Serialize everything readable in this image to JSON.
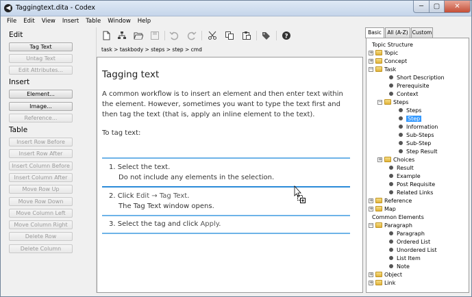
{
  "window": {
    "title": "Taggingtext.dita - Codex",
    "min": "─",
    "max": "▢",
    "close": "✕",
    "app_icon": "◀"
  },
  "menu": [
    "File",
    "Edit",
    "View",
    "Insert",
    "Table",
    "Window",
    "Help"
  ],
  "left": {
    "edit_heading": "Edit",
    "edit_buttons": [
      {
        "label": "Tag Text",
        "enabled": true
      },
      {
        "label": "Untag Text",
        "enabled": false
      },
      {
        "label": "Edit Attributes...",
        "enabled": false
      }
    ],
    "insert_heading": "Insert",
    "insert_buttons": [
      {
        "label": "Element...",
        "enabled": true
      },
      {
        "label": "Image...",
        "enabled": true
      },
      {
        "label": "Reference...",
        "enabled": false
      }
    ],
    "table_heading": "Table",
    "table_buttons": [
      {
        "label": "Insert Row Before",
        "enabled": false
      },
      {
        "label": "Insert Row After",
        "enabled": false
      },
      {
        "label": "Insert Column Before",
        "enabled": false
      },
      {
        "label": "Insert Column After",
        "enabled": false
      },
      {
        "label": "Move Row Up",
        "enabled": false
      },
      {
        "label": "Move Row Down",
        "enabled": false
      },
      {
        "label": "Move Column Left",
        "enabled": false
      },
      {
        "label": "Move Column Right",
        "enabled": false
      },
      {
        "label": "Delete Row",
        "enabled": false
      },
      {
        "label": "Delete Column",
        "enabled": false
      }
    ]
  },
  "toolbar": [
    "new-file-icon",
    "structure-icon",
    "open-folder-icon",
    "save-icon",
    "undo-icon",
    "redo-icon",
    "cut-icon",
    "copy-icon",
    "paste-icon",
    "tags-icon",
    "help-icon"
  ],
  "breadcrumb": "task > taskbody > steps > step > cmd",
  "editor": {
    "title": "Tagging text",
    "para": "A common workflow is to insert an element and then enter text within the element. However, sometimes you want to type the text first and then tag the text (that is, apply an inline element to the text).",
    "intro": "To tag text:",
    "steps": [
      {
        "num": "1.",
        "pre": "Select the text.",
        "sub": "Do not include any elements in the selection."
      },
      {
        "num": "2.",
        "pre": "Click ",
        "ui": "Edit → Tag Text",
        "post": ".",
        "sub": "The Tag Text window opens."
      },
      {
        "num": "3.",
        "pre": "Select the tag and click ",
        "ui": "Apply",
        "post": "."
      }
    ]
  },
  "tabs": [
    "Basic",
    "All (A-Z)",
    "Custom"
  ],
  "tree": [
    {
      "label": "Topic Structure",
      "depth": 0,
      "kind": "root"
    },
    {
      "label": "Topic",
      "depth": 1,
      "kind": "folder",
      "exp": "+"
    },
    {
      "label": "Concept",
      "depth": 1,
      "kind": "folder",
      "exp": "+"
    },
    {
      "label": "Task",
      "depth": 1,
      "kind": "folder",
      "exp": "−"
    },
    {
      "label": "Short Description",
      "depth": 2,
      "kind": "leaf"
    },
    {
      "label": "Prerequisite",
      "depth": 2,
      "kind": "leaf"
    },
    {
      "label": "Context",
      "depth": 2,
      "kind": "leaf"
    },
    {
      "label": "Steps",
      "depth": 2,
      "kind": "folder",
      "exp": "−"
    },
    {
      "label": "Steps",
      "depth": 3,
      "kind": "leaf"
    },
    {
      "label": "Step",
      "depth": 3,
      "kind": "leaf",
      "selected": true
    },
    {
      "label": "Information",
      "depth": 3,
      "kind": "leaf"
    },
    {
      "label": "Sub-Steps",
      "depth": 3,
      "kind": "leaf"
    },
    {
      "label": "Sub-Step",
      "depth": 3,
      "kind": "leaf"
    },
    {
      "label": "Step Result",
      "depth": 3,
      "kind": "leaf"
    },
    {
      "label": "Choices",
      "depth": 2,
      "kind": "folder",
      "exp": "+"
    },
    {
      "label": "Result",
      "depth": 2,
      "kind": "leaf"
    },
    {
      "label": "Example",
      "depth": 2,
      "kind": "leaf"
    },
    {
      "label": "Post Requisite",
      "depth": 2,
      "kind": "leaf"
    },
    {
      "label": "Related Links",
      "depth": 2,
      "kind": "leaf"
    },
    {
      "label": "Reference",
      "depth": 1,
      "kind": "folder",
      "exp": "+"
    },
    {
      "label": "Map",
      "depth": 1,
      "kind": "folder",
      "exp": "+"
    },
    {
      "label": "Common Elements",
      "depth": 0,
      "kind": "root"
    },
    {
      "label": "Paragraph",
      "depth": 1,
      "kind": "folder",
      "exp": "−"
    },
    {
      "label": "Paragraph",
      "depth": 2,
      "kind": "leaf"
    },
    {
      "label": "Ordered List",
      "depth": 2,
      "kind": "leaf"
    },
    {
      "label": "Unordered List",
      "depth": 2,
      "kind": "leaf"
    },
    {
      "label": "List Item",
      "depth": 2,
      "kind": "leaf"
    },
    {
      "label": "Note",
      "depth": 2,
      "kind": "leaf"
    },
    {
      "label": "Object",
      "depth": 1,
      "kind": "folder",
      "exp": "+"
    },
    {
      "label": "Link",
      "depth": 1,
      "kind": "folder",
      "exp": "+"
    }
  ]
}
